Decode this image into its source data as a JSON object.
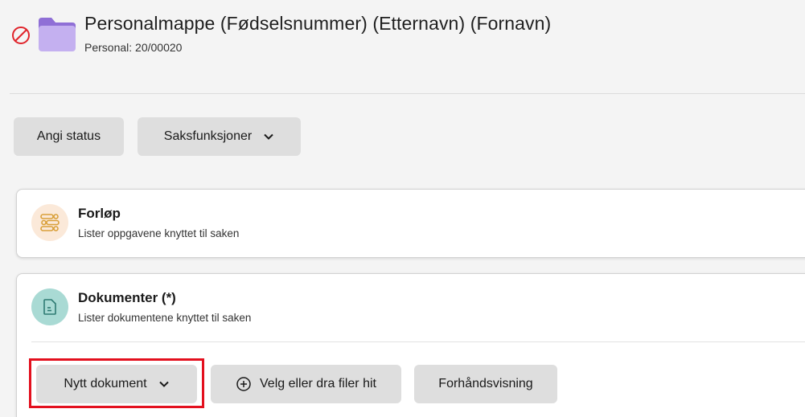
{
  "header": {
    "title": "Personalmappe (Fødselsnummer) (Etternavn) (Fornavn)",
    "subtitle": "Personal: 20/00020"
  },
  "actions": {
    "status_label": "Angi status",
    "saks_label": "Saksfunksjoner"
  },
  "forlop": {
    "title": "Forløp",
    "description": "Lister oppgavene knyttet til saken"
  },
  "dokumenter": {
    "title": "Dokumenter (*)",
    "description": "Lister dokumentene knyttet til saken",
    "buttons": {
      "nytt": "Nytt dokument",
      "velg": "Velg eller dra filer hit",
      "forhand": "Forhåndsvisning"
    }
  },
  "icons": {
    "status": "no-entry-icon",
    "folder": "folder-icon",
    "forlop": "workflow-icon",
    "dokumenter": "document-icon"
  },
  "colors": {
    "folder": "#a98fe0",
    "forlop_icon_bg": "#fbe9d9",
    "dokument_icon_bg": "#a9dad4",
    "highlight": "#e3101e",
    "button_bg": "#dedede"
  }
}
